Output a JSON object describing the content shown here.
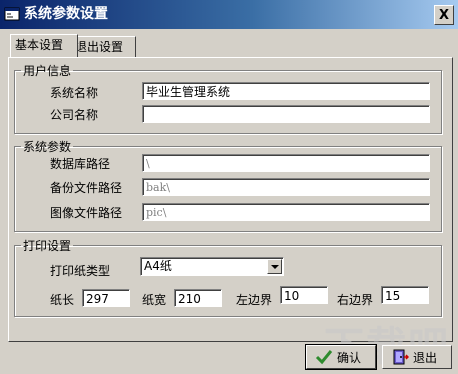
{
  "window": {
    "title": "系统参数设置",
    "close_label": "X"
  },
  "tabs": [
    {
      "label": "基本设置",
      "active": true
    },
    {
      "label": "退出设置",
      "active": false
    }
  ],
  "user_info": {
    "legend": "用户信息",
    "system_name_label": "系统名称",
    "system_name_value": "毕业生管理系统",
    "company_name_label": "公司名称",
    "company_name_value": ""
  },
  "system_params": {
    "legend": "系统参数",
    "db_path_label": "数据库路径",
    "db_path_value": "\\",
    "backup_path_label": "备份文件路径",
    "backup_path_value": "bak\\",
    "image_path_label": "图像文件路径",
    "image_path_value": "pic\\"
  },
  "print_settings": {
    "legend": "打印设置",
    "paper_type_label": "打印纸类型",
    "paper_type_value": "A4纸",
    "paper_length_label": "纸长",
    "paper_length_value": "297",
    "paper_width_label": "纸宽",
    "paper_width_value": "210",
    "left_margin_label": "左边界",
    "left_margin_value": "10",
    "right_margin_label": "右边界",
    "right_margin_value": "15"
  },
  "buttons": {
    "ok_label": "确认",
    "exit_label": "退出"
  },
  "watermark": "下载吧",
  "colors": {
    "titlebar": "#0a246a",
    "face": "#d4d0c8",
    "ok_icon": "#2e8b2e"
  }
}
